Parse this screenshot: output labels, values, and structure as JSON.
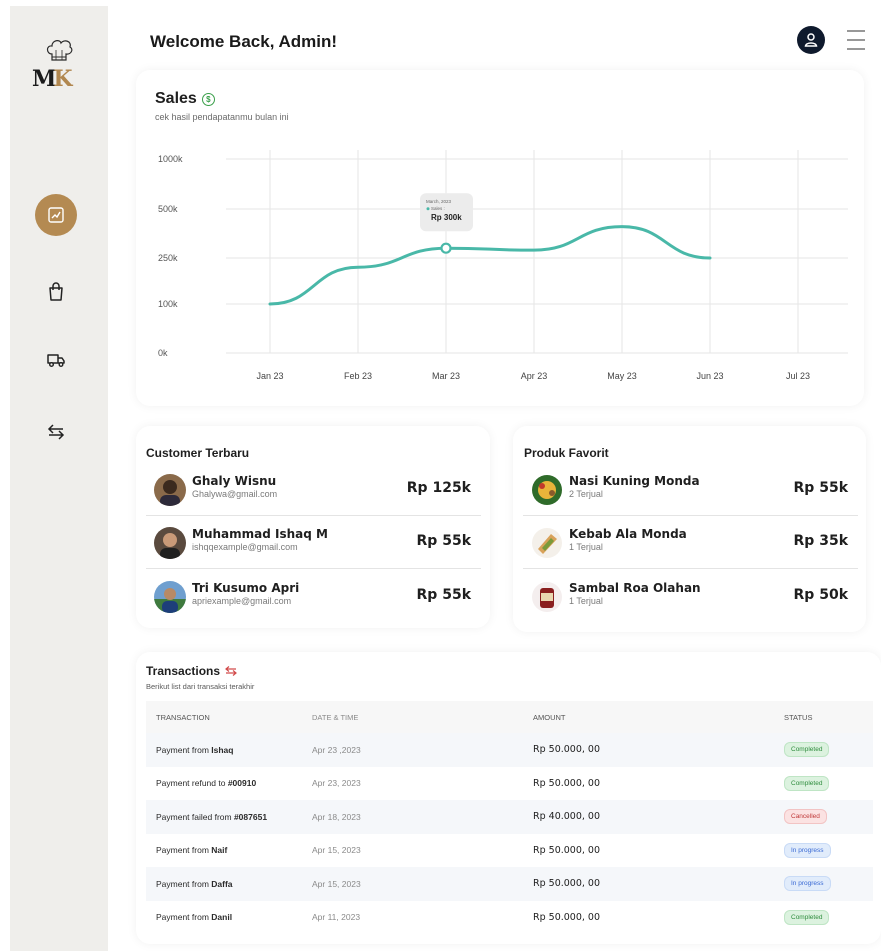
{
  "header": {
    "welcome": "Welcome Back, Admin!"
  },
  "sidebar": {
    "logo_text": "MK",
    "items": [
      {
        "icon": "chart-icon",
        "active": true
      },
      {
        "icon": "shopping-bag-icon",
        "active": false
      },
      {
        "icon": "truck-icon",
        "active": false
      },
      {
        "icon": "transfer-icon",
        "active": false
      }
    ]
  },
  "sales": {
    "title": "Sales",
    "coin_symbol": "$",
    "subtitle": "cek hasil pendapatanmu bulan ini",
    "tooltip": {
      "date": "March, 2023",
      "series": "Sales :",
      "value": "Rp 300k"
    }
  },
  "chart_data": {
    "type": "line",
    "title": "Sales",
    "y_tick_labels": [
      "1000k",
      "500k",
      "250k",
      "100k",
      "0k"
    ],
    "categories": [
      "Jan 23",
      "Feb 23",
      "Mar 23",
      "Apr 23",
      "May 23",
      "Jun 23",
      "Jul 23"
    ],
    "series": [
      {
        "name": "Sales",
        "x": [
          "Jan 23",
          "Feb 23",
          "Mar 23",
          "Apr 23",
          "May 23",
          "Jun 23"
        ],
        "values": [
          100,
          220,
          300,
          290,
          410,
          250
        ]
      }
    ],
    "highlight": {
      "x": "Mar 23",
      "value": 300
    },
    "grid": true,
    "color": "#49b8a8"
  },
  "customers": {
    "title": "Customer Terbaru",
    "items": [
      {
        "name": "Ghaly Wisnu",
        "email": "Ghalywa@gmail.com",
        "amount": "Rp 125k"
      },
      {
        "name": "Muhammad Ishaq M",
        "email": "ishqqexample@gmail.com",
        "amount": "Rp 55k"
      },
      {
        "name": "Tri Kusumo Apri",
        "email": "apriexample@gmail.com",
        "amount": "Rp 55k"
      }
    ]
  },
  "products": {
    "title": "Produk Favorit",
    "items": [
      {
        "name": "Nasi Kuning Monda",
        "sold": "2 Terjual",
        "price": "Rp 55k"
      },
      {
        "name": "Kebab Ala Monda",
        "sold": "1 Terjual",
        "price": "Rp 35k"
      },
      {
        "name": "Sambal Roa Olahan",
        "sold": "1 Terjual",
        "price": "Rp 50k"
      }
    ]
  },
  "transactions": {
    "title": "Transactions",
    "subtitle": "Berikut list dari transaksi terakhir",
    "columns": [
      "TRANSACTION",
      "DATE & TIME",
      "AMOUNT",
      "STATUS"
    ],
    "rows": [
      {
        "prefix": "Payment from ",
        "target": "Ishaq",
        "date": "Apr 23 ,2023",
        "amount": "Rp 50.000, 00",
        "status": "Completed",
        "kind": "completed"
      },
      {
        "prefix": "Payment refund to ",
        "target": "#00910",
        "date": "Apr 23, 2023",
        "amount": "Rp 50.000, 00",
        "status": "Completed",
        "kind": "completed"
      },
      {
        "prefix": "Payment failed from ",
        "target": "#087651",
        "date": "Apr 18, 2023",
        "amount": "Rp 40.000, 00",
        "status": "Cancelled",
        "kind": "cancelled"
      },
      {
        "prefix": "Payment from ",
        "target": "Naif",
        "date": "Apr 15, 2023",
        "amount": "Rp 50.000, 00",
        "status": "In progress",
        "kind": "progress"
      },
      {
        "prefix": "Payment from ",
        "target": "Daffa",
        "date": "Apr 15, 2023",
        "amount": "Rp 50.000, 00",
        "status": "In progress",
        "kind": "progress"
      },
      {
        "prefix": "Payment from ",
        "target": "Danil",
        "date": "Apr 11, 2023",
        "amount": "Rp 50.000, 00",
        "status": "Completed",
        "kind": "completed"
      }
    ]
  }
}
